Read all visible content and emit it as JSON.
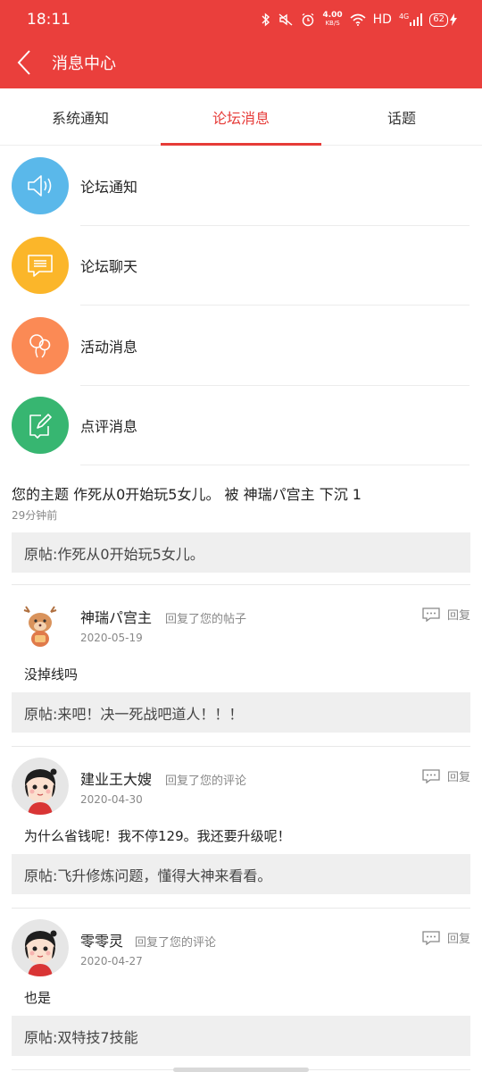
{
  "status": {
    "time": "18:11",
    "net_speed": "4.00",
    "net_unit": "KB/S",
    "hd": "HD",
    "signal": "4G",
    "battery": "62"
  },
  "header": {
    "title": "消息中心"
  },
  "tabs": [
    {
      "label": "系统通知",
      "active": false
    },
    {
      "label": "论坛消息",
      "active": true
    },
    {
      "label": "话题",
      "active": false
    }
  ],
  "categories": [
    {
      "label": "论坛通知",
      "icon": "speaker-icon",
      "color": "#5ab8ea"
    },
    {
      "label": "论坛聊天",
      "icon": "chat-icon",
      "color": "#fbb62a"
    },
    {
      "label": "活动消息",
      "icon": "balloon-icon",
      "color": "#fb8a55"
    },
    {
      "label": "点评消息",
      "icon": "edit-icon",
      "color": "#37b671"
    }
  ],
  "notice": {
    "text": "您的主题 作死从0开始玩5女儿。 被 神瑞パ宫主 下沉 1",
    "time": "29分钟前",
    "original": "原帖:作死从0开始玩5女儿。"
  },
  "comments": [
    {
      "name": "神瑞パ宫主",
      "action": "回复了您的帖子",
      "date": "2020-05-19",
      "reply_label": "回复",
      "body": "没掉线吗",
      "original": "原帖:来吧！决一死战吧道人！！！",
      "avatar": "deer-avatar"
    },
    {
      "name": "建业王大嫂",
      "action": "回复了您的评论",
      "date": "2020-04-30",
      "reply_label": "回复",
      "body": "为什么省钱呢！我不停129。我还要升级呢！",
      "original": "原帖:飞升修炼问题，懂得大神来看看。",
      "avatar": "girl-avatar"
    },
    {
      "name": "零零灵",
      "action": "回复了您的评论",
      "date": "2020-04-27",
      "reply_label": "回复",
      "body": "也是",
      "original": "原帖:双特技7技能",
      "avatar": "girl-avatar"
    }
  ],
  "colors": {
    "brand_red": "#ea3f3c",
    "tab_active": "#e63b38"
  }
}
